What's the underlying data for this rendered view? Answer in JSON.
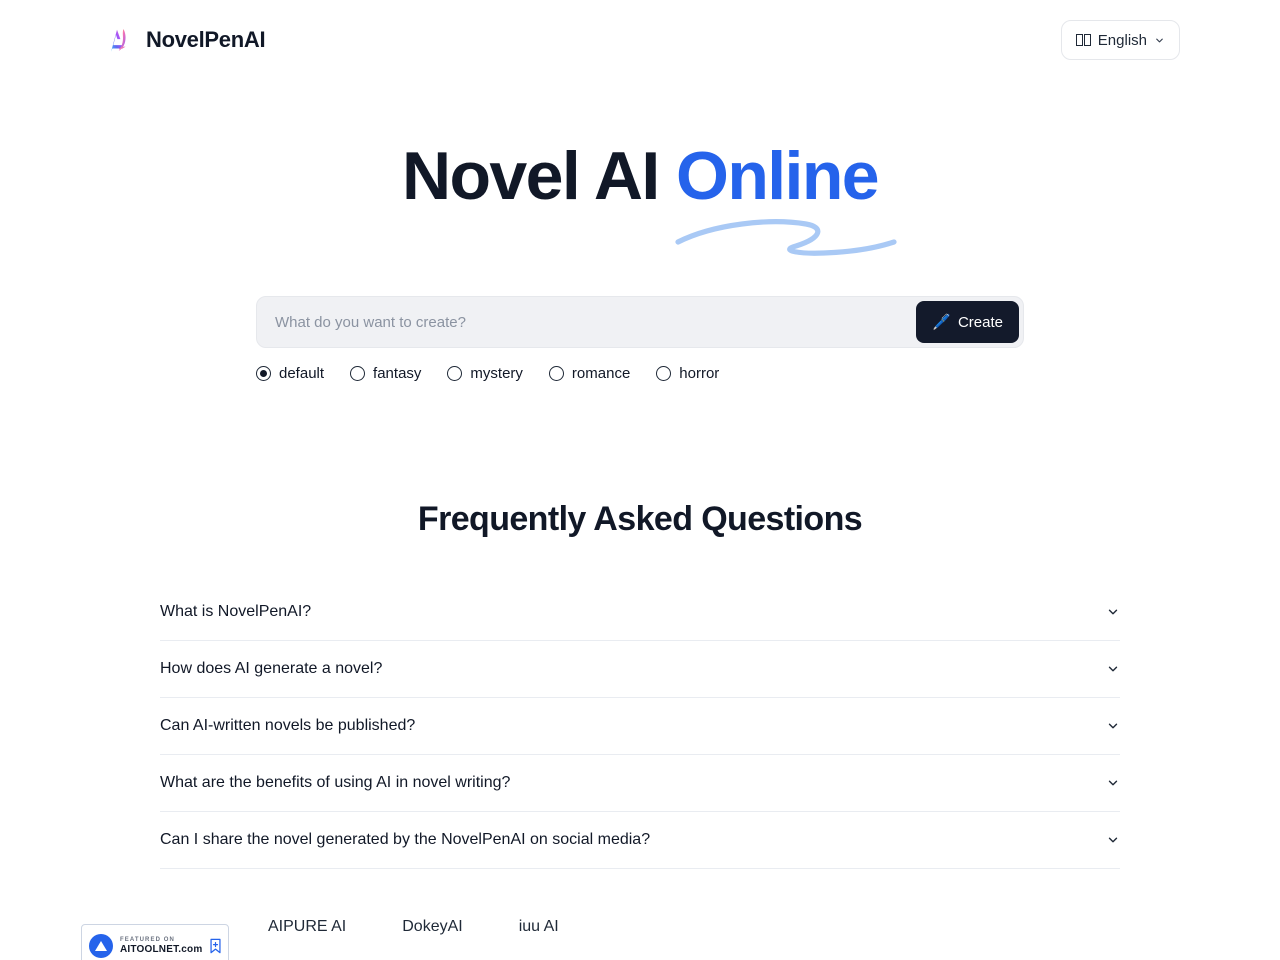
{
  "header": {
    "brand_name": "NovelPenAI",
    "logo_icon": "novelpen-gradient-logo",
    "language": {
      "label": "English",
      "flag_icon": "flag-placeholder",
      "chevron_icon": "chevron-down-icon"
    }
  },
  "hero": {
    "title_main": "Novel AI ",
    "title_accent": "Online",
    "underline_icon": "hand-drawn-swoosh"
  },
  "search": {
    "placeholder": "What do you want to create?",
    "value": "",
    "create_label": "Create",
    "create_icon": "pencil-icon",
    "create_emoji": "🖊️"
  },
  "genres": {
    "selected": "default",
    "options": [
      {
        "label": "default",
        "checked": true
      },
      {
        "label": "fantasy",
        "checked": false
      },
      {
        "label": "mystery",
        "checked": false
      },
      {
        "label": "romance",
        "checked": false
      },
      {
        "label": "horror",
        "checked": false
      }
    ]
  },
  "faq": {
    "title": "Frequently Asked Questions",
    "items": [
      {
        "question": "What is NovelPenAI?",
        "chevron_icon": "chevron-down-icon"
      },
      {
        "question": "How does AI generate a novel?",
        "chevron_icon": "chevron-down-icon"
      },
      {
        "question": "Can AI-written novels be published?",
        "chevron_icon": "chevron-down-icon"
      },
      {
        "question": "What are the benefits of using AI in novel writing?",
        "chevron_icon": "chevron-down-icon"
      },
      {
        "question": "Can I share the novel generated by the NovelPenAI on social media?",
        "chevron_icon": "chevron-down-icon"
      }
    ]
  },
  "footer": {
    "badge": {
      "featured_on": "Featured on",
      "site": "AITOOLNET.com",
      "mark_icon": "aitoolnet-triangle-icon",
      "bookmark_icon": "bookmark-icon"
    },
    "links": [
      {
        "label": "AIPURE AI"
      },
      {
        "label": "DokeyAI"
      },
      {
        "label": "iuu AI"
      }
    ]
  },
  "colors": {
    "accent_blue": "#2563eb",
    "swoosh_blue": "#a9c9f5",
    "ink": "#111827",
    "button_dark": "#131a2b",
    "input_bg": "#f0f1f4",
    "divider": "#e9ecf1"
  }
}
